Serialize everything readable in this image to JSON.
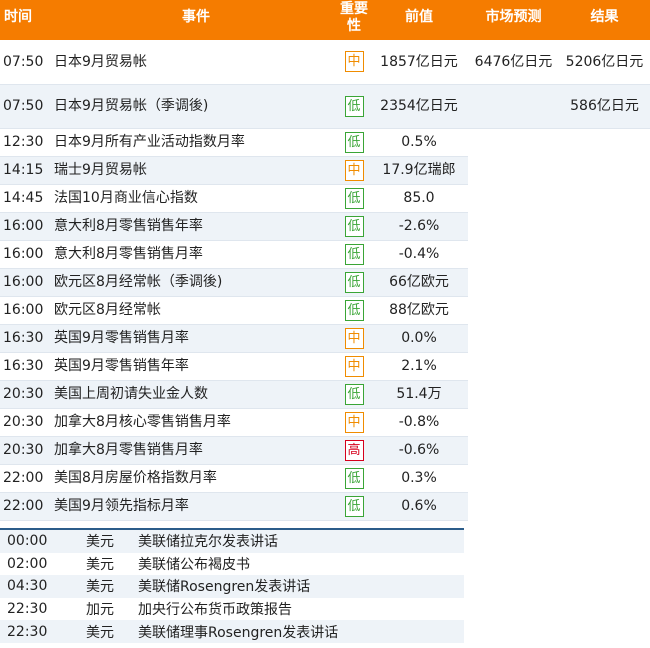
{
  "headers": {
    "time": "时间",
    "event": "事件",
    "importance": "重要性",
    "previous": "前值",
    "forecast": "市场预测",
    "result": "结果"
  },
  "rows": [
    {
      "time": "07:50",
      "event": "日本9月贸易帐",
      "importance": "中",
      "level": "mid",
      "previous": "1857亿日元",
      "forecast": "6476亿日元",
      "result": "5206亿日元"
    },
    {
      "time": "07:50",
      "event": "日本9月贸易帐（季调後)",
      "importance": "低",
      "level": "low",
      "previous": "2354亿日元",
      "forecast": "",
      "result": "586亿日元"
    },
    {
      "time": "12:30",
      "event": "日本9月所有产业活动指数月率",
      "importance": "低",
      "level": "low",
      "previous": "0.5%",
      "forecast": "",
      "result": ""
    },
    {
      "time": "14:15",
      "event": "瑞士9月贸易帐",
      "importance": "中",
      "level": "mid",
      "previous": "17.9亿瑞郎",
      "forecast": "",
      "result": ""
    },
    {
      "time": "14:45",
      "event": "法国10月商业信心指数",
      "importance": "低",
      "level": "low",
      "previous": "85.0",
      "forecast": "",
      "result": ""
    },
    {
      "time": "16:00",
      "event": "意大利8月零售销售年率",
      "importance": "低",
      "level": "low",
      "previous": "-2.6%",
      "forecast": "",
      "result": ""
    },
    {
      "time": "16:00",
      "event": "意大利8月零售销售月率",
      "importance": "低",
      "level": "low",
      "previous": "-0.4%",
      "forecast": "",
      "result": ""
    },
    {
      "time": "16:00",
      "event": "欧元区8月经常帐（季调後)",
      "importance": "低",
      "level": "low",
      "previous": "66亿欧元",
      "forecast": "",
      "result": ""
    },
    {
      "time": "16:00",
      "event": "欧元区8月经常帐",
      "importance": "低",
      "level": "low",
      "previous": "88亿欧元",
      "forecast": "",
      "result": ""
    },
    {
      "time": "16:30",
      "event": "英国9月零售销售月率",
      "importance": "中",
      "level": "mid",
      "previous": "0.0%",
      "forecast": "",
      "result": ""
    },
    {
      "time": "16:30",
      "event": "英国9月零售销售年率",
      "importance": "中",
      "level": "mid",
      "previous": "2.1%",
      "forecast": "",
      "result": ""
    },
    {
      "time": "20:30",
      "event": "美国上周初请失业金人数",
      "importance": "低",
      "level": "low",
      "previous": "51.4万",
      "forecast": "",
      "result": ""
    },
    {
      "time": "20:30",
      "event": "加拿大8月核心零售销售月率",
      "importance": "中",
      "level": "mid",
      "previous": "-0.8%",
      "forecast": "",
      "result": ""
    },
    {
      "time": "20:30",
      "event": "加拿大8月零售销售月率",
      "importance": "高",
      "level": "high",
      "previous": "-0.6%",
      "forecast": "",
      "result": ""
    },
    {
      "time": "22:00",
      "event": "美国8月房屋价格指数月率",
      "importance": "低",
      "level": "low",
      "previous": "0.3%",
      "forecast": "",
      "result": ""
    },
    {
      "time": "22:00",
      "event": "美国9月领先指标月率",
      "importance": "低",
      "level": "low",
      "previous": "0.6%",
      "forecast": "",
      "result": ""
    }
  ],
  "events": [
    {
      "time": "00:00",
      "currency": "美元",
      "event": "美联储拉克尔发表讲话"
    },
    {
      "time": "02:00",
      "currency": "美元",
      "event": "美联储公布褐皮书"
    },
    {
      "time": "04:30",
      "currency": "美元",
      "event": "美联储Rosengren发表讲话"
    },
    {
      "time": "22:30",
      "currency": "加元",
      "event": "加央行公布货币政策报告"
    },
    {
      "time": "22:30",
      "currency": "美元",
      "event": "美联储理事Rosengren发表讲话"
    }
  ],
  "colors": {
    "header_bg": "#f57c00",
    "importance_mid": "#f08c00",
    "importance_low": "#3aa536",
    "importance_high": "#d6001c",
    "separator": "#2b5c8a"
  }
}
